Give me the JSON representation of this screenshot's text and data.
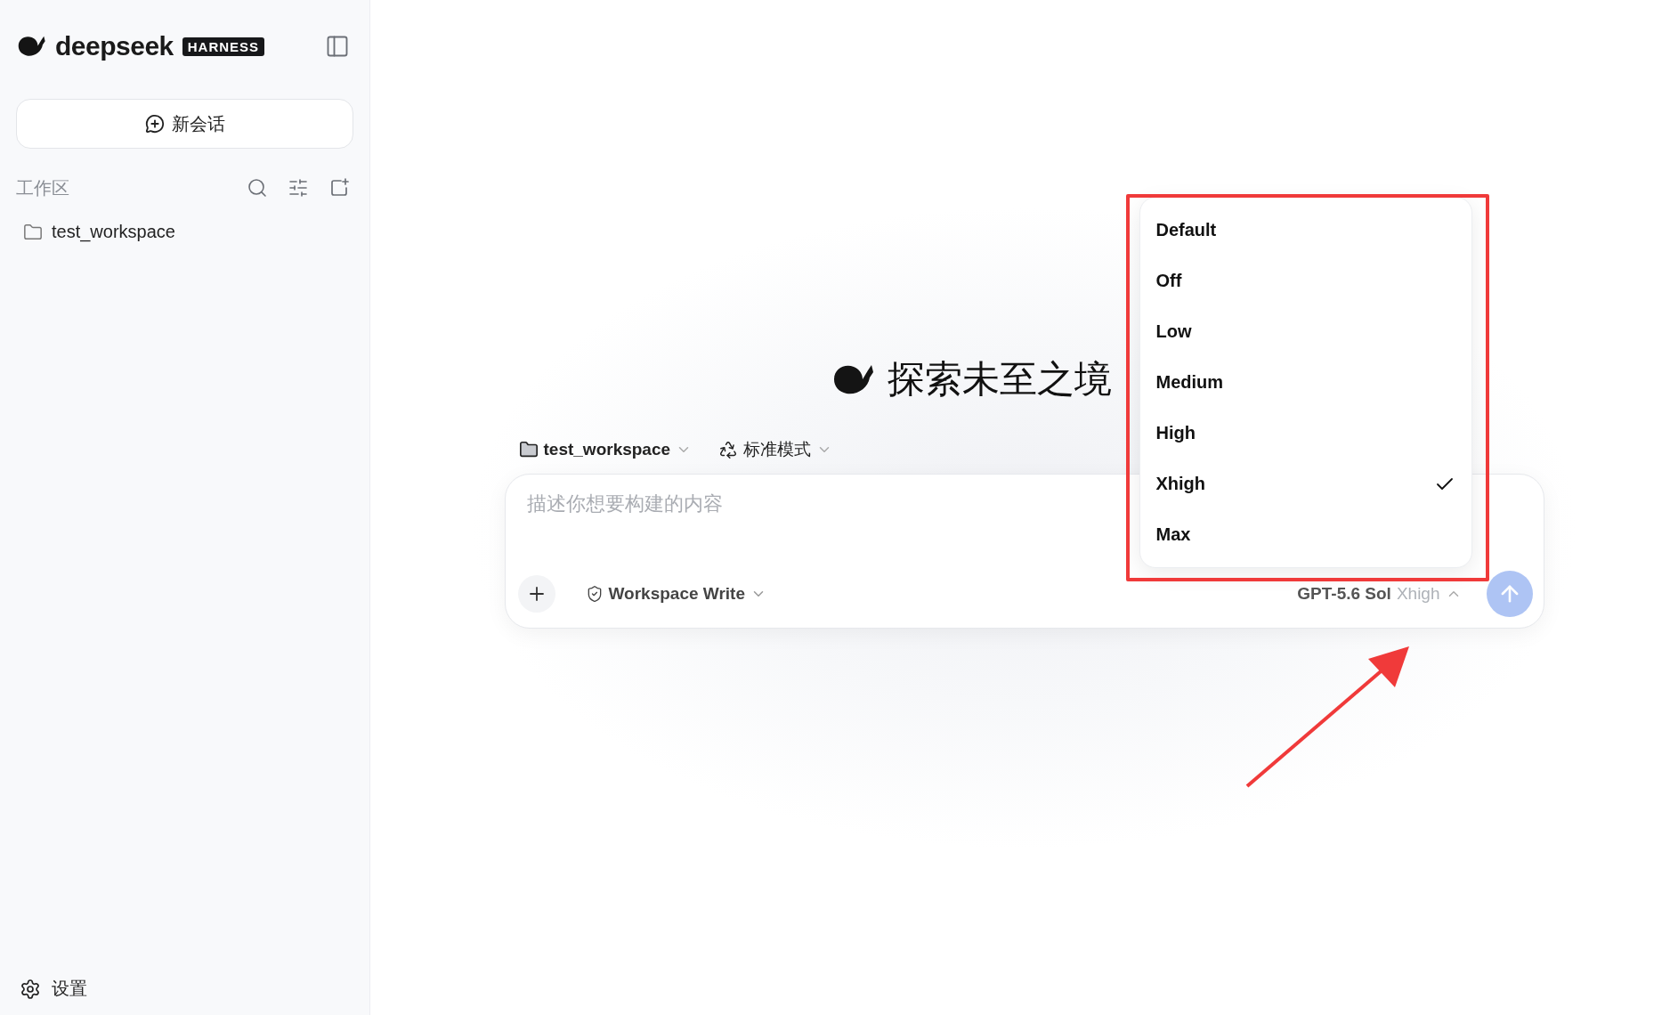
{
  "sidebar": {
    "brand": "deepseek",
    "badge": "HARNESS",
    "new_chat": "新会话",
    "section_title": "工作区",
    "workspaces": [
      {
        "name": "test_workspace"
      }
    ],
    "settings": "设置"
  },
  "hero": {
    "title": "探索未至之境"
  },
  "composer": {
    "workspace": "test_workspace",
    "mode": "标准模式",
    "placeholder": "描述你想要构建的内容",
    "permission": "Workspace Write",
    "model": "GPT-5.6 Sol",
    "effort": "Xhigh",
    "send_disabled": true
  },
  "effort_menu": {
    "options": [
      {
        "label": "Default",
        "selected": false
      },
      {
        "label": "Off",
        "selected": false
      },
      {
        "label": "Low",
        "selected": false
      },
      {
        "label": "Medium",
        "selected": false
      },
      {
        "label": "High",
        "selected": false
      },
      {
        "label": "Xhigh",
        "selected": true
      },
      {
        "label": "Max",
        "selected": false
      }
    ]
  }
}
